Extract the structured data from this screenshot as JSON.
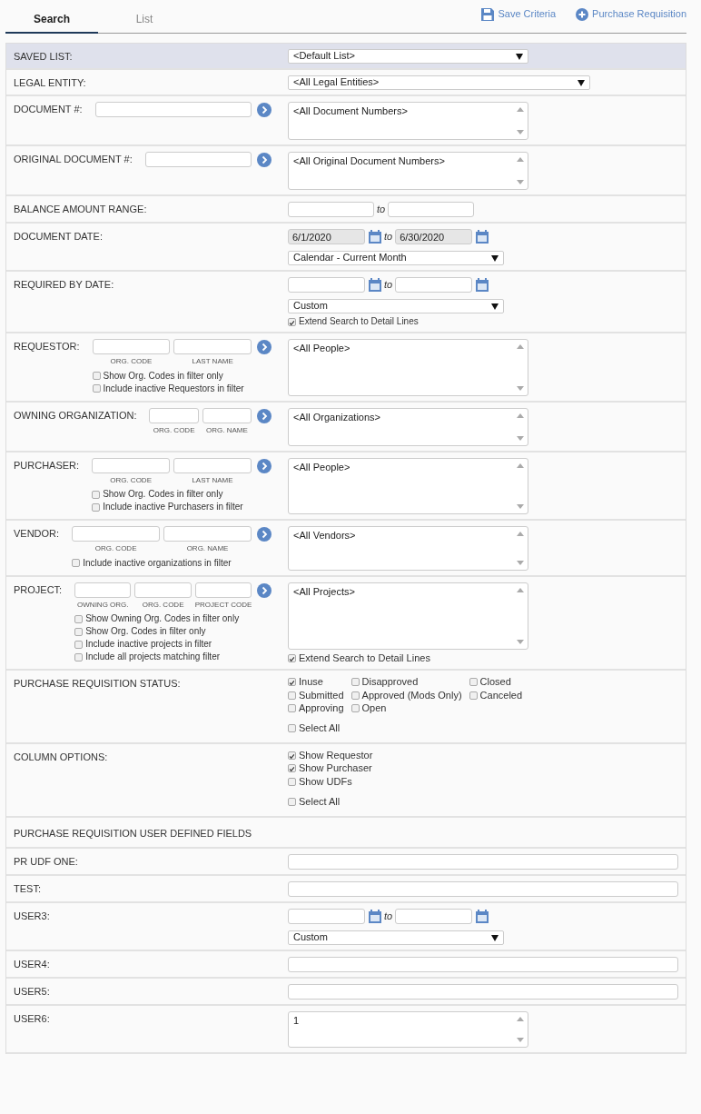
{
  "tabs": [
    {
      "label": "Search",
      "selected": true
    },
    {
      "label": "List",
      "selected": false
    }
  ],
  "actions": [
    {
      "kind": "save",
      "label": "Save Criteria"
    },
    {
      "kind": "add",
      "label": "Purchase Requisition"
    }
  ],
  "rows": [
    {
      "kind": "select",
      "label": "SAVED LIST:",
      "highlighted": true,
      "value": "<Default List>",
      "wide": false
    },
    {
      "kind": "select",
      "label": "LEGAL ENTITY:",
      "highlighted": false,
      "value": "<All Legal Entities>",
      "wide": true
    },
    {
      "kind": "lookup",
      "label": "DOCUMENT #:",
      "inputs": [
        {
          "kind": "text"
        }
      ],
      "list": "<All Document Numbers>"
    },
    {
      "kind": "lookup",
      "label": "ORIGINAL DOCUMENT #:",
      "inputs": [
        {
          "kind": "text"
        }
      ],
      "list": "<All Original Document Numbers>"
    },
    {
      "kind": "range",
      "label": "BALANCE AMOUNT RANGE:",
      "to_label": "to",
      "calendar": false,
      "from": {
        "disabled": false
      },
      "to": {
        "disabled": false
      }
    },
    {
      "kind": "range",
      "label": "DOCUMENT DATE:",
      "to_label": "to",
      "calendar": true,
      "from": {
        "value": "6/1/2020",
        "disabled": true
      },
      "to": {
        "value": "6/30/2020",
        "disabled": true
      },
      "select": "Calendar - Current Month"
    },
    {
      "kind": "range",
      "label": "REQUIRED BY DATE:",
      "to_label": "to",
      "calendar": true,
      "from": {
        "disabled": false
      },
      "to": {
        "disabled": false
      },
      "select": "Custom",
      "option": {
        "label": "Extend Search to Detail Lines",
        "checked": true
      }
    },
    {
      "kind": "lookup",
      "label": "REQUESTOR:",
      "inputs": [
        {
          "kind": "text",
          "caption": "ORG. CODE"
        },
        {
          "kind": "text",
          "caption": "LAST NAME"
        }
      ],
      "options": [
        {
          "label": "Show Org. Codes in filter only",
          "checked": false
        },
        {
          "label": "Include inactive Requestors in filter",
          "checked": false
        }
      ],
      "list": "<All People>"
    },
    {
      "kind": "lookup",
      "label": "OWNING ORGANIZATION:",
      "inputs": [
        {
          "kind": "text",
          "caption": "ORG. CODE"
        },
        {
          "kind": "text",
          "caption": "ORG. NAME"
        }
      ],
      "list": "<All Organizations>"
    },
    {
      "kind": "lookup",
      "label": "PURCHASER:",
      "inputs": [
        {
          "kind": "text",
          "caption": "ORG. CODE"
        },
        {
          "kind": "text",
          "caption": "LAST NAME"
        }
      ],
      "options": [
        {
          "label": "Show Org. Codes in filter only",
          "checked": false
        },
        {
          "label": "Include inactive Purchasers in filter",
          "checked": false
        }
      ],
      "list": "<All People>"
    },
    {
      "kind": "lookup",
      "label": "VENDOR:",
      "inputs": [
        {
          "kind": "text",
          "caption": "ORG. CODE"
        },
        {
          "kind": "text",
          "caption": "ORG. NAME"
        }
      ],
      "options": [
        {
          "label": "Include inactive organizations in filter",
          "checked": false
        }
      ],
      "list": "<All Vendors>"
    },
    {
      "kind": "lookup",
      "label": "PROJECT:",
      "inputs": [
        {
          "kind": "text",
          "caption": "OWNING ORG."
        },
        {
          "kind": "text",
          "caption": "ORG. CODE"
        },
        {
          "kind": "text",
          "caption": "PROJECT CODE"
        }
      ],
      "options": [
        {
          "label": "Show Owning Org. Codes in filter only",
          "checked": false
        },
        {
          "label": "Show Org. Codes in filter only",
          "checked": false
        },
        {
          "label": "Include inactive projects in filter",
          "checked": false
        },
        {
          "label": "Include all projects matching filter",
          "checked": false
        }
      ],
      "list": "<All Projects>",
      "list_option": {
        "label": "Extend Search to Detail Lines",
        "checked": true
      }
    },
    {
      "kind": "checks",
      "label": "PURCHASE REQUISITION STATUS:",
      "columns": [
        [
          {
            "label": "Inuse",
            "checked": true
          },
          {
            "label": "Submitted",
            "checked": false
          },
          {
            "label": "Approving",
            "checked": false
          }
        ],
        [
          {
            "label": "Disapproved",
            "checked": false
          },
          {
            "label": "Approved (Mods Only)",
            "checked": false
          },
          {
            "label": "Open",
            "checked": false
          }
        ],
        [
          {
            "label": "Closed",
            "checked": false
          },
          {
            "label": "Canceled",
            "checked": false
          }
        ]
      ],
      "select_all": {
        "label": "Select All",
        "checked": false
      }
    },
    {
      "kind": "checks",
      "label": "COLUMN OPTIONS:",
      "columns": [
        [
          {
            "label": "Show Requestor",
            "checked": true
          },
          {
            "label": "Show Purchaser",
            "checked": true
          },
          {
            "label": "Show UDFs",
            "checked": false
          }
        ]
      ],
      "select_all": {
        "label": "Select All",
        "checked": false
      }
    },
    {
      "kind": "header",
      "label": "PURCHASE REQUISITION USER DEFINED FIELDS"
    },
    {
      "kind": "text",
      "label": "PR UDF ONE:"
    },
    {
      "kind": "text",
      "label": "TEST:"
    },
    {
      "kind": "range",
      "label": "USER3:",
      "to_label": "to",
      "calendar": true,
      "from": {
        "disabled": false
      },
      "to": {
        "disabled": false
      },
      "select": "Custom"
    },
    {
      "kind": "text",
      "label": "USER4:"
    },
    {
      "kind": "text",
      "label": "USER5:"
    },
    {
      "kind": "listbox",
      "label": "USER6:",
      "list": "1"
    }
  ]
}
